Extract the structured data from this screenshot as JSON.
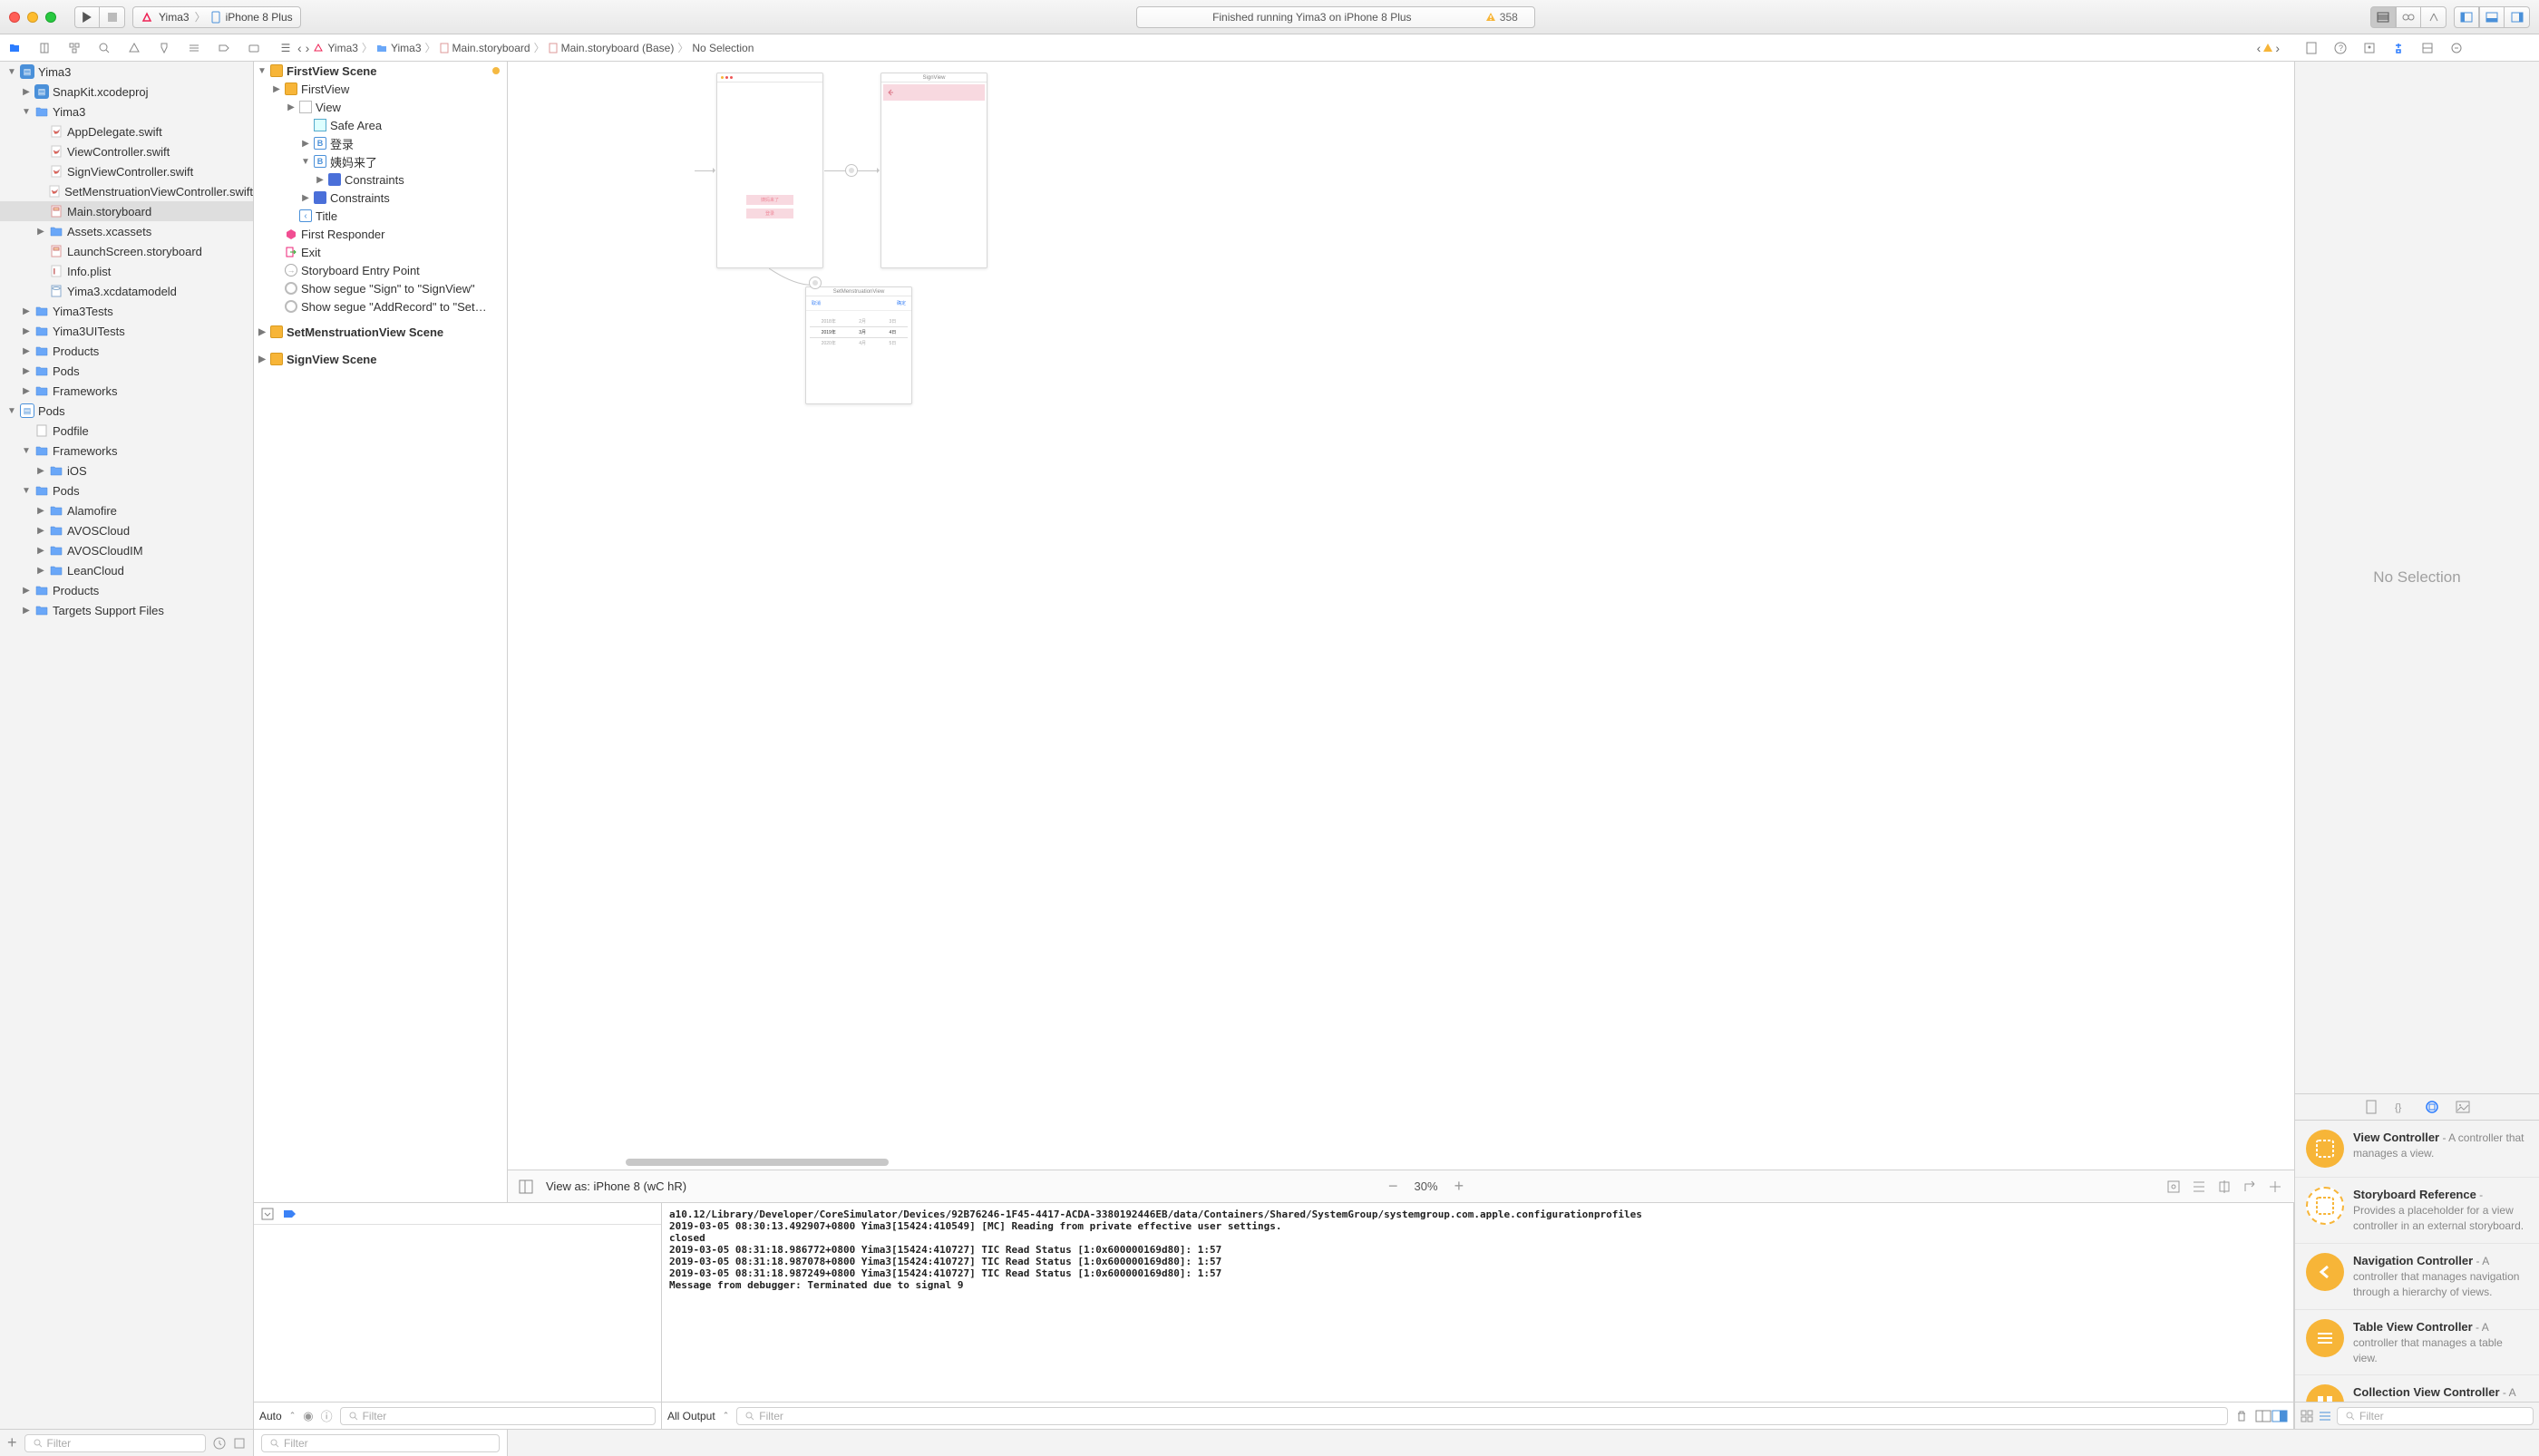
{
  "titlebar": {
    "status": "Finished running Yima3 on iPhone 8 Plus",
    "issue_count": "358",
    "scheme_app": "Yima3",
    "scheme_device": "iPhone 8 Plus"
  },
  "jumpbar": {
    "items": [
      "Yima3",
      "Yima3",
      "Main.storyboard",
      "Main.storyboard (Base)",
      "No Selection"
    ]
  },
  "navigator": {
    "project": "Yima3",
    "items": [
      {
        "t": "SnapKit.xcodeproj",
        "icon": "proj",
        "indent": 1
      },
      {
        "t": "Yima3",
        "icon": "folder",
        "indent": 1,
        "open": true
      },
      {
        "t": "AppDelegate.swift",
        "icon": "swift",
        "indent": 2
      },
      {
        "t": "ViewController.swift",
        "icon": "swift",
        "indent": 2
      },
      {
        "t": "SignViewController.swift",
        "icon": "swift",
        "indent": 2
      },
      {
        "t": "SetMenstruationViewController.swift",
        "icon": "swift",
        "indent": 2
      },
      {
        "t": "Main.storyboard",
        "icon": "sb",
        "indent": 2,
        "selected": true
      },
      {
        "t": "Assets.xcassets",
        "icon": "folder",
        "indent": 2
      },
      {
        "t": "LaunchScreen.storyboard",
        "icon": "sb",
        "indent": 2
      },
      {
        "t": "Info.plist",
        "icon": "plist",
        "indent": 2
      },
      {
        "t": "Yima3.xcdatamodeld",
        "icon": "data",
        "indent": 2
      },
      {
        "t": "Yima3Tests",
        "icon": "folder",
        "indent": 1
      },
      {
        "t": "Yima3UITests",
        "icon": "folder",
        "indent": 1
      },
      {
        "t": "Products",
        "icon": "folder",
        "indent": 1
      },
      {
        "t": "Pods",
        "icon": "folder",
        "indent": 1
      },
      {
        "t": "Frameworks",
        "icon": "folder",
        "indent": 1
      }
    ],
    "pods_project": "Pods",
    "pods_items": [
      {
        "t": "Podfile",
        "icon": "file",
        "indent": 1
      },
      {
        "t": "Frameworks",
        "icon": "folder",
        "indent": 1,
        "open": true
      },
      {
        "t": "iOS",
        "icon": "folder",
        "indent": 2
      },
      {
        "t": "Pods",
        "icon": "folder",
        "indent": 1,
        "open": true
      },
      {
        "t": "Alamofire",
        "icon": "folder",
        "indent": 2
      },
      {
        "t": "AVOSCloud",
        "icon": "folder",
        "indent": 2
      },
      {
        "t": "AVOSCloudIM",
        "icon": "folder",
        "indent": 2
      },
      {
        "t": "LeanCloud",
        "icon": "folder",
        "indent": 2
      },
      {
        "t": "Products",
        "icon": "folder",
        "indent": 1
      },
      {
        "t": "Targets Support Files",
        "icon": "folder",
        "indent": 1
      }
    ],
    "filter_placeholder": "Filter"
  },
  "outline": {
    "scene1": "FirstView Scene",
    "items": [
      {
        "t": "FirstView",
        "icon": "vc",
        "indent": 1
      },
      {
        "t": "View",
        "icon": "view",
        "indent": 2
      },
      {
        "t": "Safe Area",
        "icon": "safe",
        "indent": 3
      },
      {
        "t": "登录",
        "icon": "b",
        "indent": 3
      },
      {
        "t": "姨妈来了",
        "icon": "b",
        "indent": 3,
        "open": true
      },
      {
        "t": "Constraints",
        "icon": "con",
        "indent": 4
      },
      {
        "t": "Constraints",
        "icon": "con",
        "indent": 3
      },
      {
        "t": "Title",
        "icon": "back",
        "indent": 2
      },
      {
        "t": "First Responder",
        "icon": "cube",
        "indent": 1
      },
      {
        "t": "Exit",
        "icon": "exit",
        "indent": 1
      },
      {
        "t": "Storyboard Entry Point",
        "icon": "arrow",
        "indent": 1
      },
      {
        "t": "Show segue \"Sign\" to \"SignView\"",
        "icon": "circ",
        "indent": 1
      },
      {
        "t": "Show segue \"AddRecord\" to \"Set…",
        "icon": "circ",
        "indent": 1
      }
    ],
    "scene2": "SetMenstruationView Scene",
    "scene3": "SignView Scene",
    "filter_placeholder": "Filter"
  },
  "canvas": {
    "scene1_title": "",
    "scene2_title": "SignView",
    "scene3_title": "SetMenstruationView",
    "btn1": "姨妈来了",
    "btn2": "登录",
    "scene3_left": "取消",
    "scene3_right": "确定",
    "picker_rows": [
      [
        "2018年",
        "2月",
        "3日"
      ],
      [
        "2019年",
        "3月",
        "4日"
      ],
      [
        "2020年",
        "4月",
        "5日"
      ]
    ],
    "view_as": "View as: iPhone 8 (wC hR)",
    "zoom": "30%"
  },
  "debug": {
    "auto": "Auto",
    "filter_placeholder": "Filter",
    "all_output": "All Output",
    "console": "a10.12/Library/Developer/CoreSimulator/Devices/92B76246-1F45-4417-ACDA-3380192446EB/data/Containers/Shared/SystemGroup/systemgroup.com.apple.configurationprofiles\n2019-03-05 08:30:13.492907+0800 Yima3[15424:410549] [MC] Reading from private effective user settings.\nclosed\n2019-03-05 08:31:18.986772+0800 Yima3[15424:410727] TIC Read Status [1:0x600000169d80]: 1:57\n2019-03-05 08:31:18.987078+0800 Yima3[15424:410727] TIC Read Status [1:0x600000169d80]: 1:57\n2019-03-05 08:31:18.987249+0800 Yima3[15424:410727] TIC Read Status [1:0x600000169d80]: 1:57\nMessage from debugger: Terminated due to signal 9"
  },
  "inspector": {
    "empty": "No Selection",
    "library": [
      {
        "title": "View Controller",
        "desc": " - A controller that manages a view.",
        "kind": "solid"
      },
      {
        "title": "Storyboard Reference",
        "desc": " - Provides a placeholder for a view controller in an external storyboard.",
        "kind": "dashed"
      },
      {
        "title": "Navigation Controller",
        "desc": " - A controller that manages navigation through a hierarchy of views.",
        "kind": "nav"
      },
      {
        "title": "Table View Controller",
        "desc": " - A controller that manages a table view.",
        "kind": "table"
      },
      {
        "title": "Collection View Controller",
        "desc": " - A",
        "kind": "coll"
      }
    ],
    "filter_placeholder": "Filter"
  }
}
